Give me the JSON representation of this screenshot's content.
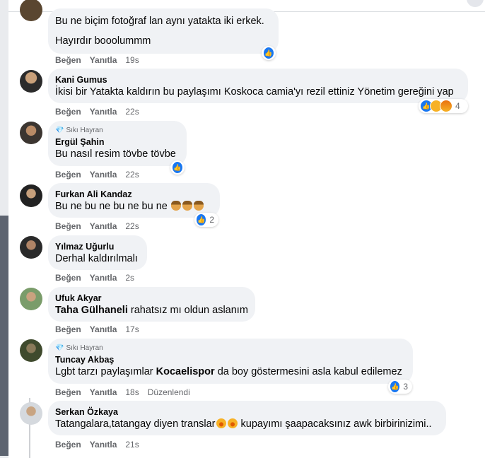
{
  "actions": {
    "like": "Beğen",
    "reply": "Yanıtla",
    "edited": "Düzenlendi"
  },
  "comments": [
    {
      "author": "",
      "badge": "",
      "lines": [
        "Bu ne biçim fotoğraf lan aynı yatakta iki erkek.",
        "Hayırdır booolummm"
      ],
      "time": "19s",
      "reactions": {
        "types": [
          "like"
        ],
        "count": ""
      }
    },
    {
      "author": "Kani Gumus",
      "badge": "",
      "text": "İkisi bir Yatakta kaldırın bu paylaşımı Koskoca camia'yı rezil ettiniz Yönetim gereğini yap",
      "time": "22s",
      "reactions": {
        "types": [
          "like",
          "haha",
          "angry"
        ],
        "count": "4"
      }
    },
    {
      "author": "Ergül Şahin",
      "badge": "Sıkı Hayran",
      "text": "Bu nasıl resim tövbe tövbe",
      "time": "22s",
      "reactions": {
        "types": [
          "like"
        ],
        "count": ""
      }
    },
    {
      "author": "Furkan Ali Kandaz",
      "badge": "",
      "text": "Bu ne bu ne bu ne bu ne",
      "time": "22s",
      "reactions": {
        "types": [
          "like"
        ],
        "count": "2"
      }
    },
    {
      "author": "Yılmaz Uğurlu",
      "badge": "",
      "text": "Derhal kaldırılmalı",
      "time": "2s"
    },
    {
      "author": "Ufuk Akyar",
      "badge": "",
      "mention": "Taha Gülhaneli",
      "text": "rahatsız mı oldun aslanım",
      "time": "17s"
    },
    {
      "author": "Tuncay Akbaş",
      "badge": "Sıkı Hayran",
      "text_before": "Lgbt tarzı paylaşımlar",
      "mention": "Kocaelispor",
      "text_after": "da boy göstermesini asla kabul edilemez",
      "time": "18s",
      "reactions": {
        "types": [
          "like"
        ],
        "count": "3"
      }
    },
    {
      "author": "Serkan Özkaya",
      "badge": "",
      "text_before": "Tatangalara,tatangay diyen translar",
      "text_after": "kupayımı şaapacaksınız awk birbirinizimi..",
      "time": "21s"
    }
  ]
}
